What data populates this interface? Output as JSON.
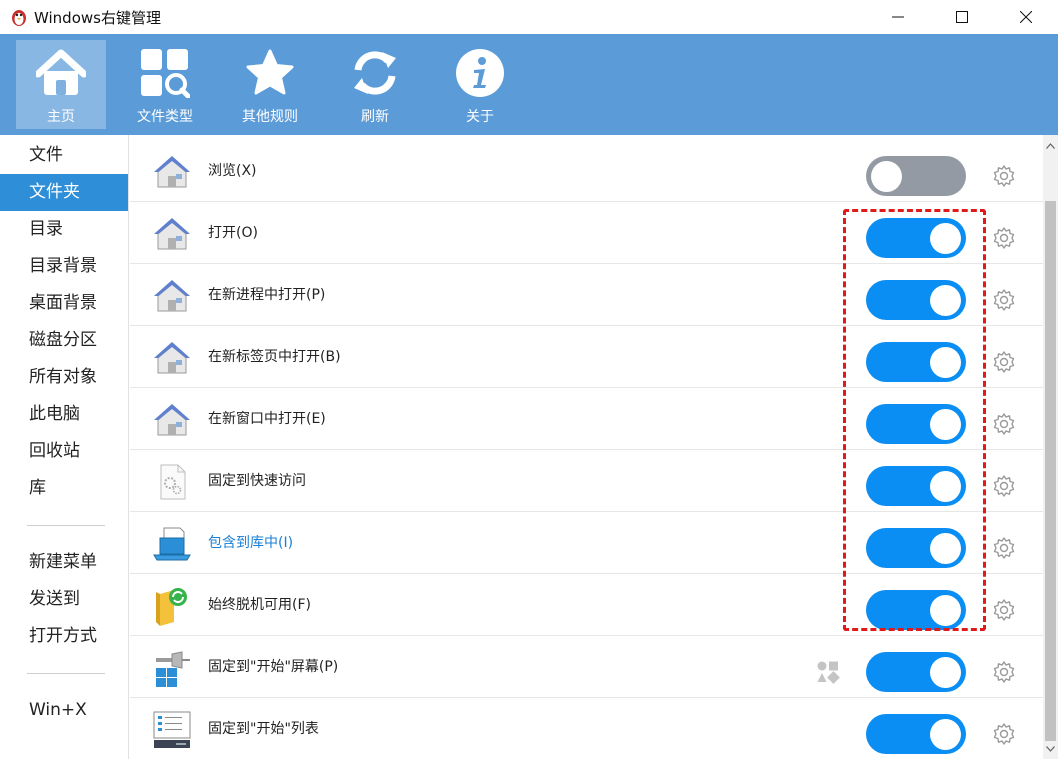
{
  "window": {
    "title": "Windows右键管理"
  },
  "toolbar": {
    "items": [
      {
        "label": "主页",
        "icon": "home-icon",
        "active": true
      },
      {
        "label": "文件类型",
        "icon": "file-types-search-icon"
      },
      {
        "label": "其他规则",
        "icon": "star-icon"
      },
      {
        "label": "刷新",
        "icon": "refresh-icon"
      },
      {
        "label": "关于",
        "icon": "info-icon"
      }
    ]
  },
  "sidebar": {
    "items": [
      {
        "label": "文件"
      },
      {
        "label": "文件夹",
        "active": true
      },
      {
        "label": "目录"
      },
      {
        "label": "目录背景"
      },
      {
        "label": "桌面背景"
      },
      {
        "label": "磁盘分区"
      },
      {
        "label": "所有对象"
      },
      {
        "label": "此电脑"
      },
      {
        "label": "回收站"
      },
      {
        "label": "库"
      },
      {
        "label": "新建菜单"
      },
      {
        "label": "发送到"
      },
      {
        "label": "打开方式"
      },
      {
        "label": "Win+X"
      }
    ]
  },
  "rows": [
    {
      "label": "浏览(X)",
      "icon": "house-icon",
      "enabled": false
    },
    {
      "label": "打开(O)",
      "icon": "house-icon",
      "enabled": true
    },
    {
      "label": "在新进程中打开(P)",
      "icon": "house-icon",
      "enabled": true
    },
    {
      "label": "在新标签页中打开(B)",
      "icon": "house-icon",
      "enabled": true
    },
    {
      "label": "在新窗口中打开(E)",
      "icon": "house-icon",
      "enabled": true
    },
    {
      "label": "固定到快速访问",
      "icon": "settings-file-icon",
      "enabled": true
    },
    {
      "label": "包含到库中(I)",
      "icon": "library-icon",
      "enabled": true,
      "link": true
    },
    {
      "label": "始终脱机可用(F)",
      "icon": "sync-folder-icon",
      "enabled": true
    },
    {
      "label": "固定到\"开始\"屏幕(P)",
      "icon": "pin-start-icon",
      "enabled": true,
      "extra_icon": "shapes-icon"
    },
    {
      "label": "固定到\"开始\"列表",
      "icon": "start-list-icon",
      "enabled": true
    }
  ],
  "colors": {
    "toolbar_bg": "#5b9bd8",
    "active_sidebar": "#2e8fd8",
    "toggle_on": "#0a8ef3",
    "toggle_off": "#939aa3",
    "highlight_box": "#e0191b"
  }
}
